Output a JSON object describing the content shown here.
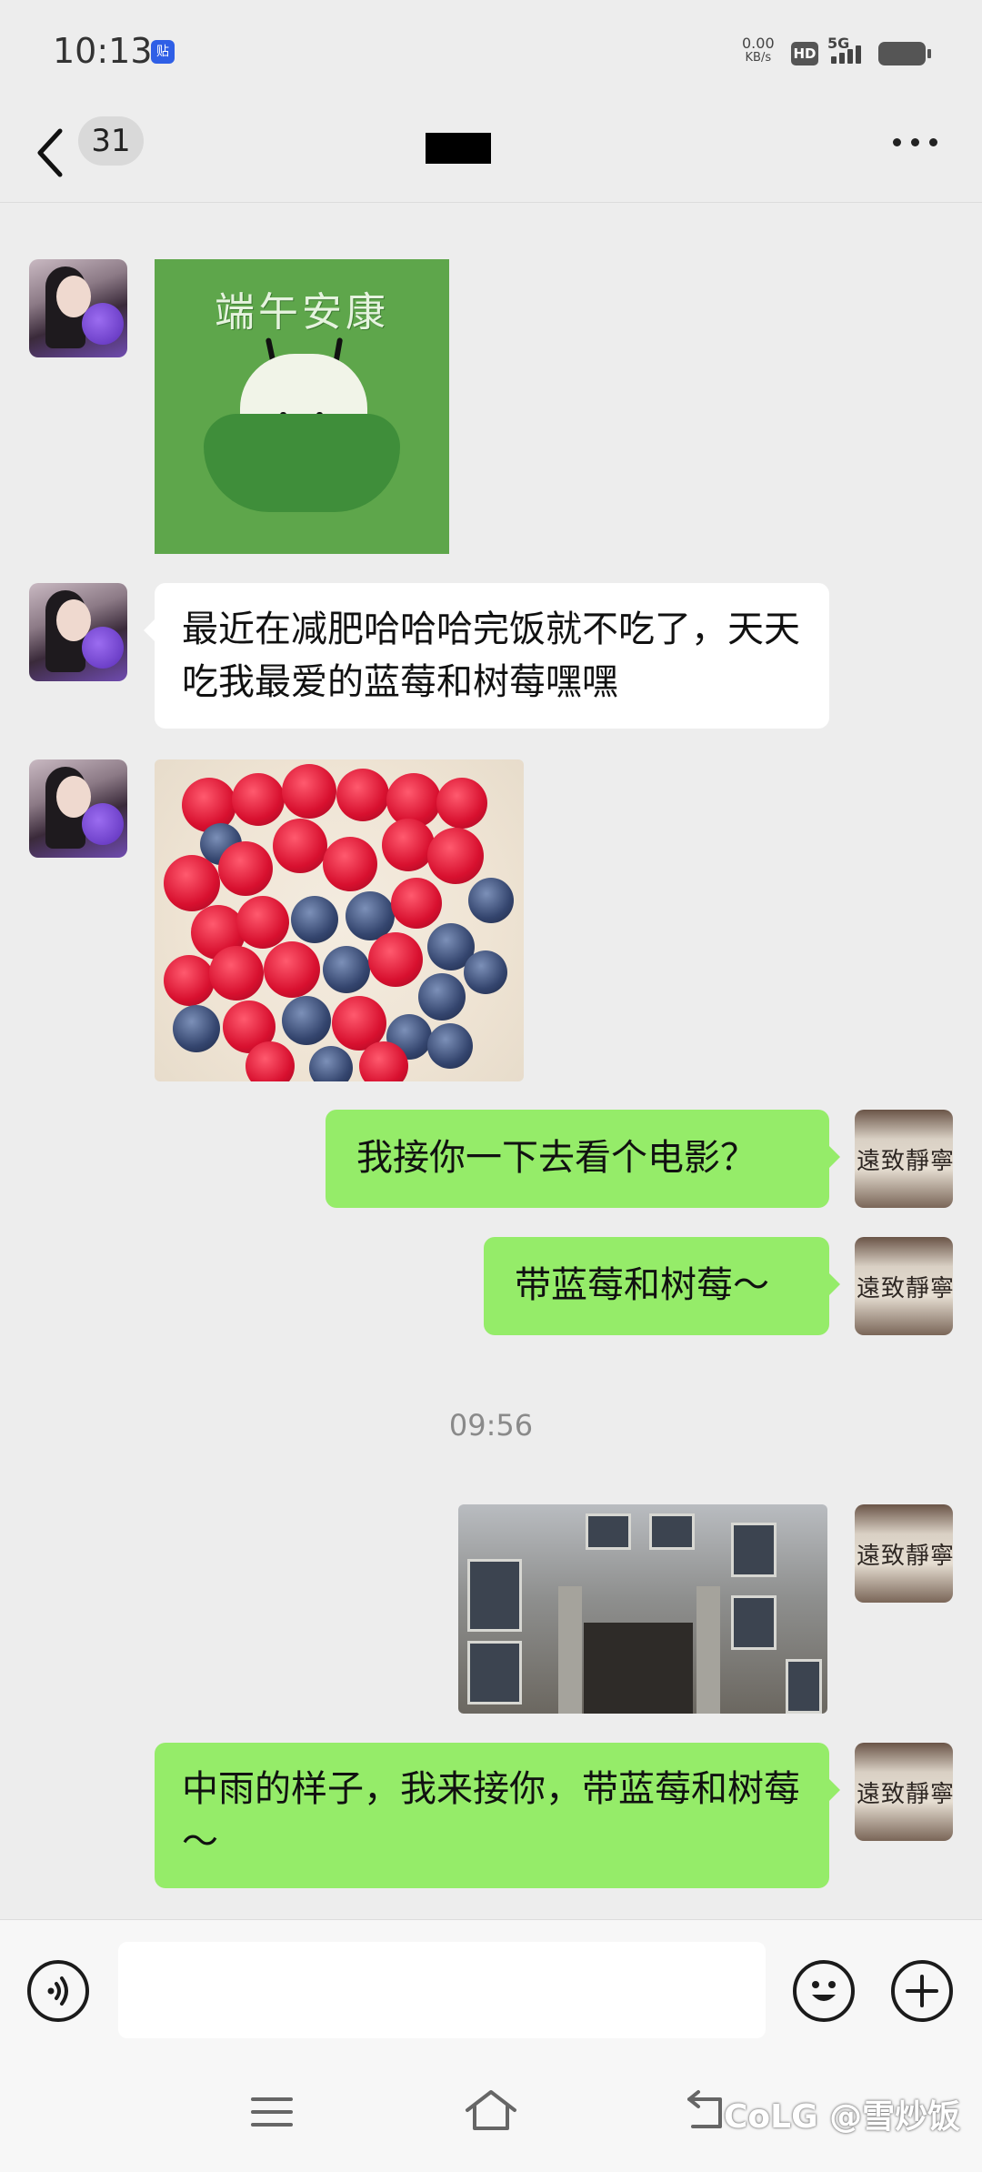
{
  "status_bar": {
    "time": "10:13",
    "net_speed_value": "0.00",
    "net_speed_unit": "KB/s",
    "hd_badge": "HD",
    "network": "5G",
    "app_badge": "贴"
  },
  "header": {
    "unread_count": "31",
    "title": ""
  },
  "messages": {
    "m1_sticker_caption": "端午安康",
    "m2_text": "最近在减肥哈哈哈完饭就不吃了，天天吃我最爱的蓝莓和树莓嘿嘿",
    "m4_text": "我接你一下去看个电影？",
    "m5_text": "带蓝莓和树莓～",
    "timestamp": "09:56",
    "m7_text": "中雨的样子，我来接你，带蓝莓和树莓～"
  },
  "avatar_right_text": "遠致靜寧",
  "input_bar": {
    "placeholder": ""
  },
  "watermark": "CoLG @雪炒饭",
  "colors": {
    "background": "#ededed",
    "bubble_self": "#95ec69",
    "bubble_other": "#ffffff"
  },
  "icons": [
    "chevron-left-icon",
    "more-dots-icon",
    "voice-icon",
    "emoji-icon",
    "plus-icon",
    "menu-icon",
    "home-icon",
    "back-nav-icon"
  ]
}
